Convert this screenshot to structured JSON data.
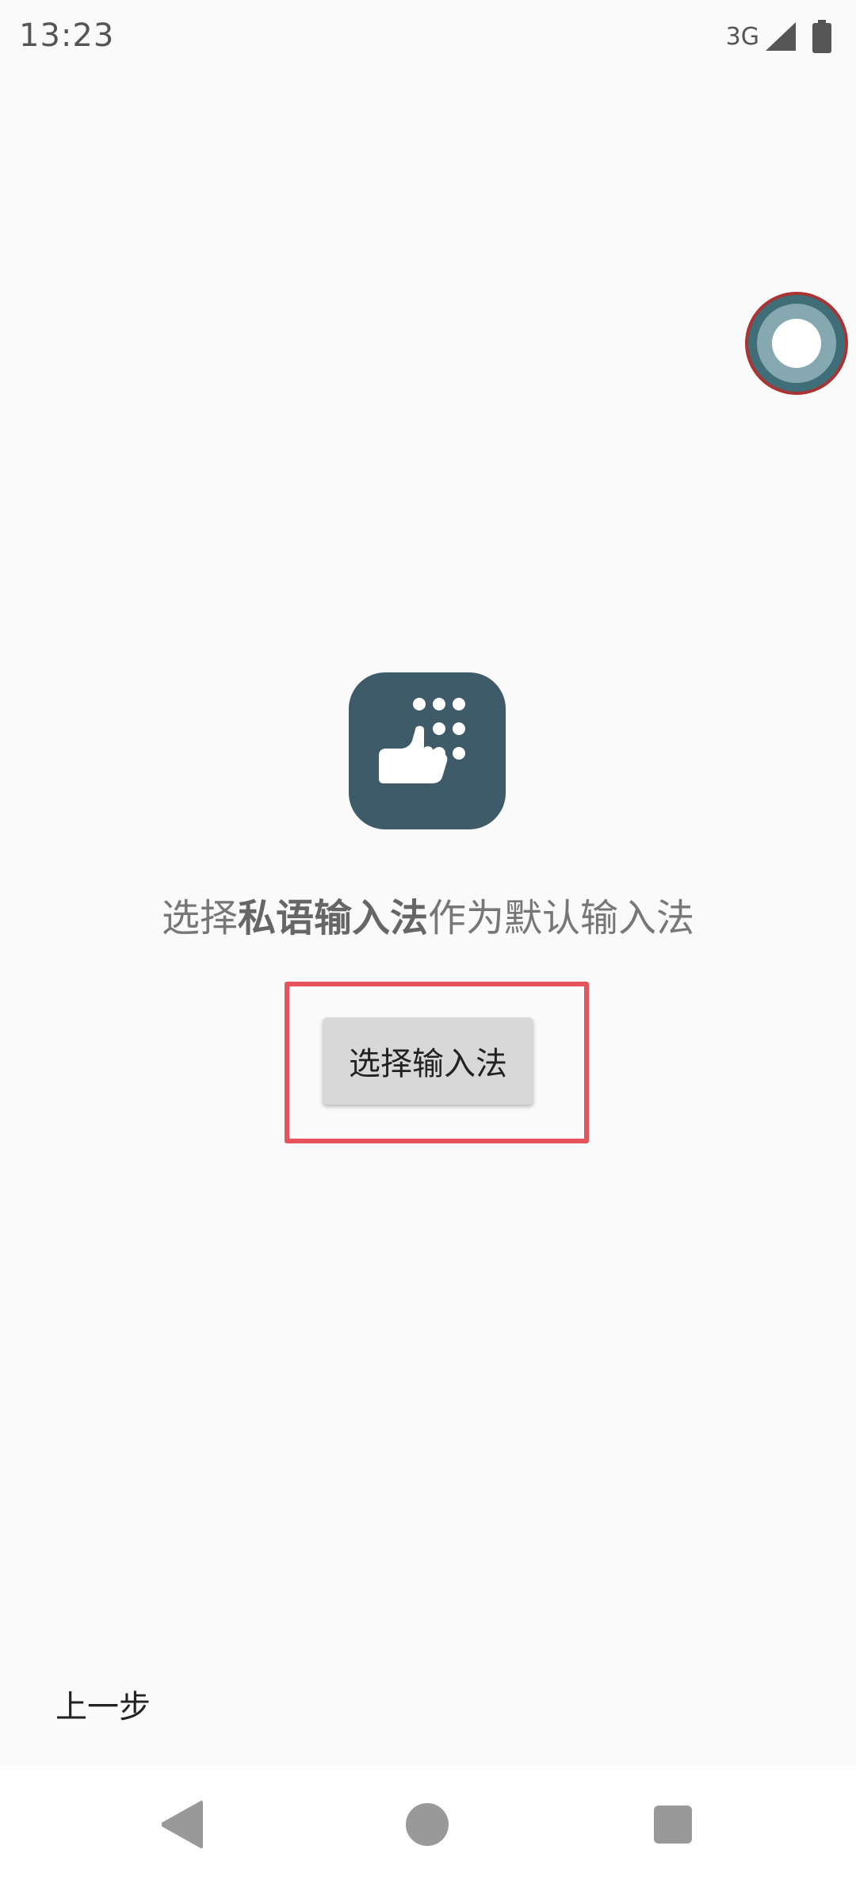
{
  "status_bar": {
    "time": "13:23",
    "network": "3G",
    "icons": [
      "signal-icon",
      "battery-icon"
    ]
  },
  "floating_bubble": {
    "icon": "assistant-bubble-icon"
  },
  "app": {
    "icon": "hand-keypad-app-icon"
  },
  "instruction": {
    "prefix": "选择",
    "app_name": "私语输入法",
    "suffix": "作为默认输入法"
  },
  "button": {
    "label": "选择输入法"
  },
  "back_link": {
    "label": "上一步"
  },
  "nav_bar": {
    "icons": [
      "back-icon",
      "home-icon",
      "recents-icon"
    ]
  },
  "colors": {
    "background": "#fafafa",
    "app_icon_bg": "#3f5a68",
    "highlight": "#e5545a",
    "button_bg": "#d8d8d8"
  }
}
